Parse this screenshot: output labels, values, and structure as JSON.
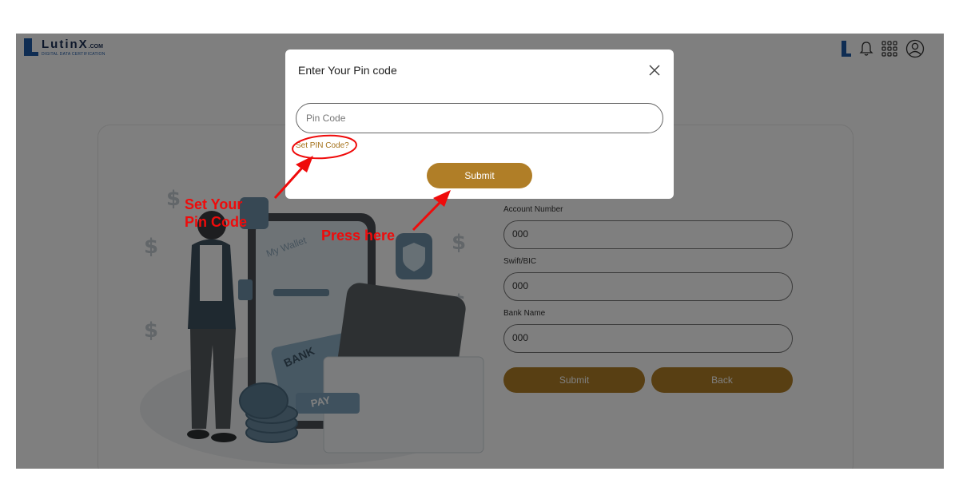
{
  "brand": {
    "name": "LutinX",
    "suffix": ".COM",
    "tagline": "DIGITAL DATA CERTIFICATION"
  },
  "header_icons": [
    "lutinx-mark-icon",
    "bell-icon",
    "apps-grid-icon",
    "user-circle-icon"
  ],
  "form": {
    "account_number_label": "Account Number",
    "account_number_value": "000",
    "swift_label": "Swift/BIC",
    "swift_value": "000",
    "bank_name_label": "Bank Name",
    "bank_name_value": "000",
    "submit_label": "Submit",
    "back_label": "Back"
  },
  "illustration": {
    "wallet_text": "My Wallet",
    "bank_text": "BANK",
    "pay_text": "PAY"
  },
  "modal": {
    "title": "Enter Your Pin code",
    "pin_placeholder": "Pin Code",
    "set_pin_link": "Set PIN Code?",
    "submit_label": "Submit"
  },
  "annotations": {
    "set_pin_line1": "Set Your",
    "set_pin_line2": "Pin Code",
    "press_here": "Press here",
    "color": "#ef0b0b"
  },
  "colors": {
    "accent": "#b07e27",
    "brand_blue": "#1f5aa6"
  }
}
